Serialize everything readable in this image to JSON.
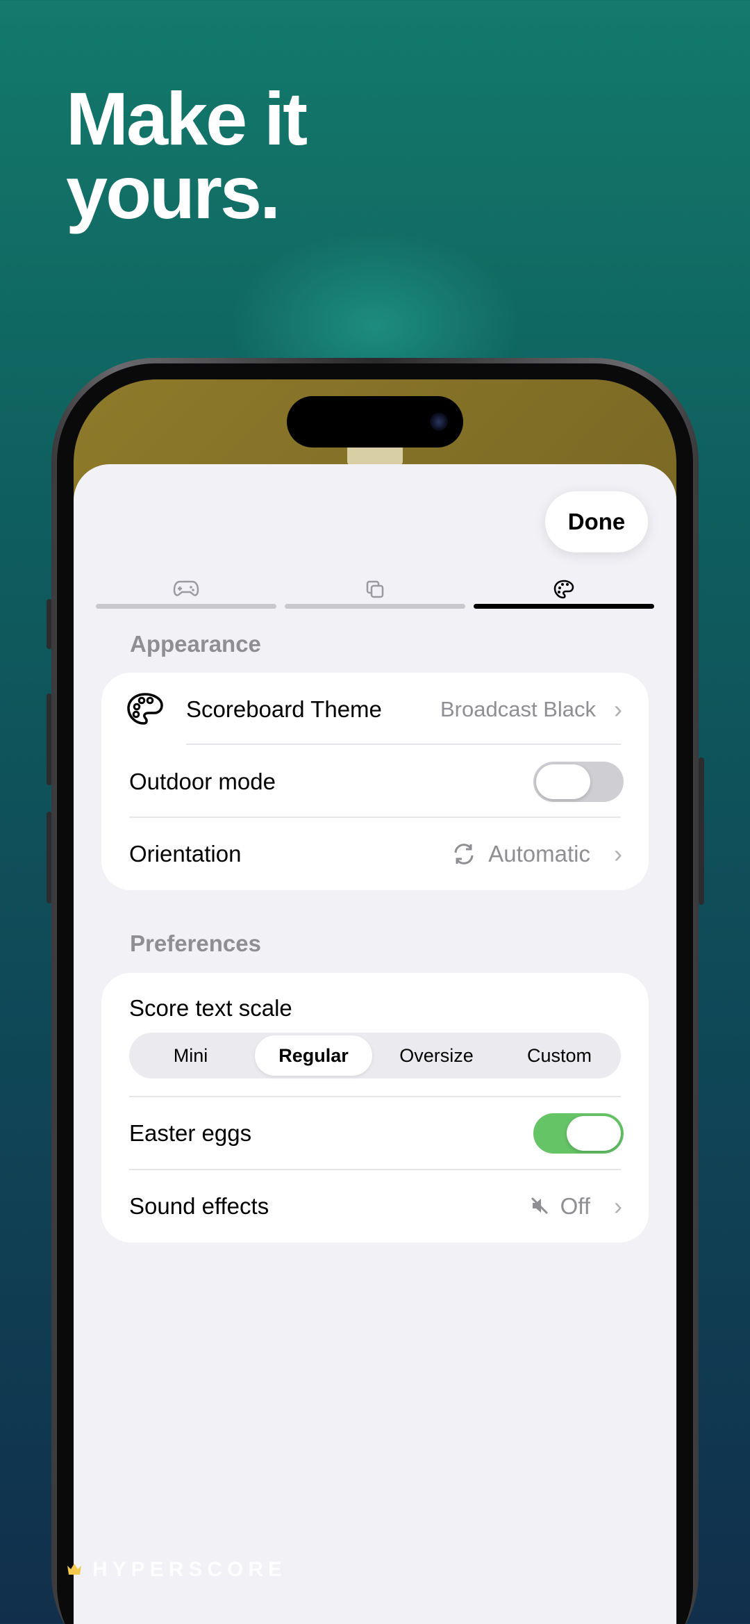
{
  "headline": {
    "line1": "Make it",
    "line2": "yours."
  },
  "done_button": "Done",
  "tabs": [
    {
      "icon": "gamepad-icon",
      "active": false
    },
    {
      "icon": "copy-icon",
      "active": false
    },
    {
      "icon": "palette-icon",
      "active": true
    }
  ],
  "appearance": {
    "title": "Appearance",
    "scoreboard_theme": {
      "label": "Scoreboard Theme",
      "value": "Broadcast Black",
      "icon": "palette-icon"
    },
    "outdoor_mode": {
      "label": "Outdoor mode",
      "on": false
    },
    "orientation": {
      "label": "Orientation",
      "value": "Automatic",
      "icon": "rotate-icon"
    }
  },
  "preferences": {
    "title": "Preferences",
    "score_text_scale": {
      "label": "Score text scale",
      "options": [
        "Mini",
        "Regular",
        "Oversize",
        "Custom"
      ],
      "selected": "Regular"
    },
    "easter_eggs": {
      "label": "Easter eggs",
      "on": true
    },
    "sound_effects": {
      "label": "Sound effects",
      "value": "Off",
      "icon": "speaker-muted-icon"
    }
  },
  "brand": {
    "name": "HYPERSCORE",
    "icon": "crown-icon"
  },
  "colors": {
    "toggle_on": "#65c466",
    "toggle_off": "#cfcfd3",
    "sheet_bg": "#f1f1f6",
    "secondary_text": "#8e8e93"
  }
}
